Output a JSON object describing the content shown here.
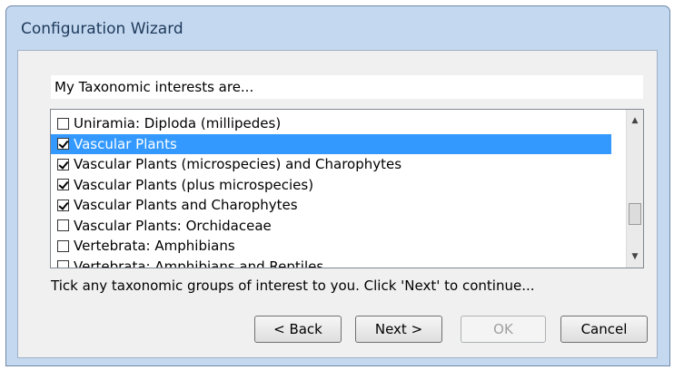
{
  "window": {
    "title": "Configuration Wizard"
  },
  "header": {
    "text": "My Taxonomic interests are..."
  },
  "list": {
    "items": [
      {
        "label": "Uniramia: Diploda (millipedes)",
        "checked": false,
        "selected": false
      },
      {
        "label": "Vascular Plants",
        "checked": true,
        "selected": true
      },
      {
        "label": "Vascular Plants (microspecies) and Charophytes",
        "checked": true,
        "selected": false
      },
      {
        "label": "Vascular Plants (plus microspecies)",
        "checked": true,
        "selected": false
      },
      {
        "label": "Vascular Plants and Charophytes",
        "checked": true,
        "selected": false
      },
      {
        "label": "Vascular Plants: Orchidaceae",
        "checked": false,
        "selected": false
      },
      {
        "label": "Vertebrata: Amphibians",
        "checked": false,
        "selected": false
      },
      {
        "label": "Vertebrata: Amphibians and Reptiles",
        "checked": false,
        "selected": false
      }
    ],
    "scroll_up_icon": "scroll-up-arrow-icon",
    "scroll_down_icon": "scroll-down-arrow-icon"
  },
  "hint": {
    "text": "Tick any taxonomic groups of interest to you.  Click 'Next' to continue..."
  },
  "buttons": {
    "back": "< Back",
    "next": "Next >",
    "ok": "OK",
    "cancel": "Cancel"
  },
  "colors": {
    "selection": "#3399ff",
    "frame": "#c4d9f0",
    "title_text": "#1e395b"
  }
}
